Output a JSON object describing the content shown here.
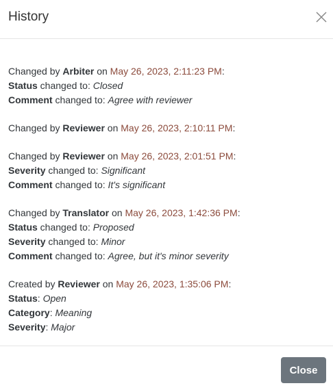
{
  "dialog": {
    "title": "History",
    "close_button": "Close"
  },
  "entries": [
    {
      "verb": "Changed by",
      "user": "Arbiter",
      "on": "on",
      "date": "May 26, 2023, 2:11:23 PM",
      "colon": ":",
      "changes": [
        {
          "field": "Status",
          "connector": " changed to: ",
          "value": "Closed"
        },
        {
          "field": "Comment",
          "connector": " changed to: ",
          "value": "Agree with reviewer"
        }
      ]
    },
    {
      "verb": "Changed by",
      "user": "Reviewer",
      "on": "on",
      "date": "May 26, 2023, 2:10:11 PM",
      "colon": ":",
      "changes": []
    },
    {
      "verb": "Changed by",
      "user": "Reviewer",
      "on": "on",
      "date": "May 26, 2023, 2:01:51 PM",
      "colon": ":",
      "changes": [
        {
          "field": "Severity",
          "connector": " changed to: ",
          "value": "Significant"
        },
        {
          "field": "Comment",
          "connector": " changed to: ",
          "value": "It's significant"
        }
      ]
    },
    {
      "verb": "Changed by",
      "user": "Translator",
      "on": "on",
      "date": "May 26, 2023, 1:42:36 PM",
      "colon": ":",
      "changes": [
        {
          "field": "Status",
          "connector": " changed to: ",
          "value": "Proposed"
        },
        {
          "field": "Severity",
          "connector": " changed to: ",
          "value": "Minor"
        },
        {
          "field": "Comment",
          "connector": " changed to: ",
          "value": "Agree, but it's minor severity"
        }
      ]
    },
    {
      "verb": "Created by",
      "user": "Reviewer",
      "on": "on",
      "date": "May 26, 2023, 1:35:06 PM",
      "colon": ":",
      "changes": [
        {
          "field": "Status",
          "connector": ": ",
          "value": "Open"
        },
        {
          "field": "Category",
          "connector": ": ",
          "value": "Meaning"
        },
        {
          "field": "Severity",
          "connector": ": ",
          "value": "Major"
        }
      ]
    }
  ]
}
